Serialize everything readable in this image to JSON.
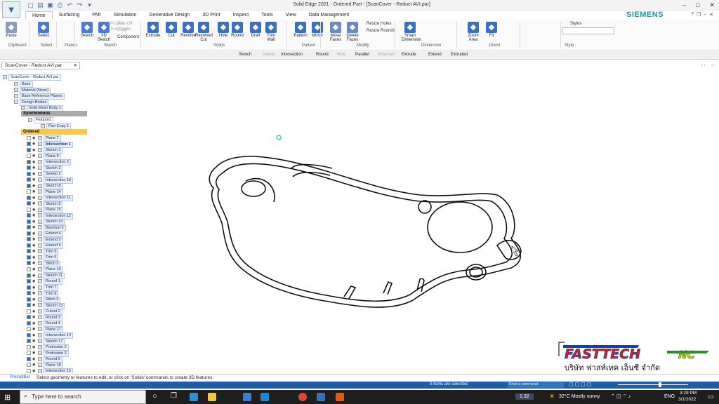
{
  "window": {
    "title": "Solid Edge 2021 - Ordered Part - [ScanCover - Reduct AVI.par]"
  },
  "tabs": [
    "Home",
    "Surfacing",
    "PMI",
    "Simulation",
    "Generative Design",
    "3D Print",
    "Inspect",
    "Tools",
    "View",
    "Data Management"
  ],
  "brand": "SIEMENS",
  "ribbon": {
    "buttons": [
      {
        "label": "Paste",
        "icon": "paste-icon"
      },
      {
        "label": "Select",
        "icon": "select-arrow-icon"
      },
      {
        "label": "Sketch",
        "icon": "sketch-icon"
      },
      {
        "label": "3D Sketch",
        "icon": "3d-sketch-icon"
      },
      {
        "label": "Extrude",
        "icon": "extrude-icon"
      },
      {
        "label": "Cut",
        "icon": "cut-icon"
      },
      {
        "label": "Revolve",
        "icon": "revolve-icon"
      },
      {
        "label": "Revolved Cut",
        "icon": "revolved-cut-icon"
      },
      {
        "label": "Hole",
        "icon": "hole-icon"
      },
      {
        "label": "Round",
        "icon": "round-icon"
      },
      {
        "label": "Draft",
        "icon": "draft-icon"
      },
      {
        "label": "Thin Wall",
        "icon": "thin-wall-icon"
      },
      {
        "label": "Pattern",
        "icon": "pattern-icon"
      },
      {
        "label": "Mirror",
        "icon": "mirror-icon"
      },
      {
        "label": "Move Faces",
        "icon": "move-faces-icon"
      },
      {
        "label": "Delete Faces",
        "icon": "delete-faces-icon"
      },
      {
        "label": "Smart Dimension",
        "icon": "smart-dimension-icon"
      },
      {
        "label": "Zoom Area",
        "icon": "zoom-area-icon"
      },
      {
        "label": "Fit",
        "icon": "fit-icon"
      }
    ],
    "small": {
      "project": "Project",
      "text_profile": "Text Profile",
      "tear_off": "Tear-Off",
      "copy": "Copy",
      "component": "Component",
      "resize_holes": "Resize Holes",
      "resize_rounds": "Resize Rounds",
      "styles": "Styles"
    },
    "groups": [
      "Clipboard",
      "Select",
      "Planes",
      "Sketch",
      "Solids",
      "Pattern",
      "Modify",
      "Dimension",
      "Orient",
      "Style"
    ]
  },
  "command_bar": [
    {
      "label": "Sketch",
      "enabled": true
    },
    {
      "label": "Delete",
      "enabled": false
    },
    {
      "label": "Intersection",
      "enabled": true
    },
    {
      "label": "Round",
      "enabled": true
    },
    {
      "label": "Hole",
      "enabled": false
    },
    {
      "label": "Parallel",
      "enabled": true
    },
    {
      "label": "Attached",
      "enabled": false
    },
    {
      "label": "Extrude",
      "enabled": true
    },
    {
      "label": "Extend",
      "enabled": true
    },
    {
      "label": "Extruded",
      "enabled": true
    }
  ],
  "document_tab": "ScanCover - Reduct AVI.par",
  "tree": {
    "root": "ScanCover - Reduct AVI.par",
    "top": [
      {
        "label": "Base",
        "type": "base"
      },
      {
        "label": "Material (None)",
        "type": "material"
      },
      {
        "label": "Base Reference Planes",
        "type": "planes"
      },
      {
        "label": "Design Bodies",
        "type": "body"
      },
      {
        "label": "Solid Mesh Body 1",
        "type": "body"
      }
    ],
    "sync_header": "Synchronous",
    "sync_children": [
      {
        "label": "Features"
      },
      {
        "label": "Part Copy 1"
      }
    ],
    "ordered_header": "Ordered",
    "ordered": [
      {
        "label": "Plane 7",
        "checked": false
      },
      {
        "label": "Intersection 1",
        "checked": true,
        "bold": true
      },
      {
        "label": "Sketch 1",
        "checked": true
      },
      {
        "label": "Plane 9",
        "checked": false
      },
      {
        "label": "Intersection 2",
        "checked": true
      },
      {
        "label": "Sketch 3",
        "checked": true
      },
      {
        "label": "Sweep 2",
        "checked": true
      },
      {
        "label": "Intersection 10",
        "checked": true
      },
      {
        "label": "Sketch 8",
        "checked": true
      },
      {
        "label": "Plane 14",
        "checked": false
      },
      {
        "label": "Intersection 11",
        "checked": true
      },
      {
        "label": "Sketch 9",
        "checked": true
      },
      {
        "label": "Plane 15",
        "checked": false
      },
      {
        "label": "Intersection 12",
        "checked": true
      },
      {
        "label": "Sketch 10",
        "checked": true
      },
      {
        "label": "BlueSurf 2",
        "checked": true
      },
      {
        "label": "Extend 4",
        "checked": true
      },
      {
        "label": "Extend 5",
        "checked": true
      },
      {
        "label": "Extend 6",
        "checked": true
      },
      {
        "label": "Trim 5",
        "checked": true
      },
      {
        "label": "Trim 6",
        "checked": true
      },
      {
        "label": "Stitch 2",
        "checked": true
      },
      {
        "label": "Plane 16",
        "checked": false
      },
      {
        "label": "Sketch 11",
        "checked": true
      },
      {
        "label": "Round 1",
        "checked": true
      },
      {
        "label": "Trim 7",
        "checked": true
      },
      {
        "label": "Trim 8",
        "checked": true
      },
      {
        "label": "Stitch 3",
        "checked": true
      },
      {
        "label": "Sketch 13",
        "checked": true
      },
      {
        "label": "Cutout 2",
        "checked": false
      },
      {
        "label": "Round 3",
        "checked": true
      },
      {
        "label": "Round 4",
        "checked": true
      },
      {
        "label": "Plane 17",
        "checked": false
      },
      {
        "label": "Intersection 14",
        "checked": true
      },
      {
        "label": "Sketch 17",
        "checked": true
      },
      {
        "label": "Protrusion 2",
        "checked": false
      },
      {
        "label": "Protrusion 3",
        "checked": false
      },
      {
        "label": "Round 5",
        "checked": true
      },
      {
        "label": "Plane 18",
        "checked": false
      },
      {
        "label": "Intersection 15",
        "checked": false
      }
    ]
  },
  "status": {
    "prompt_label": "PromptBar",
    "prompt_text": "Select geometry or features to edit, or click on 'Solids' commands to create 3D features.",
    "items_selected": "0 items are selected",
    "find_placeholder": "Find a command"
  },
  "taskbar": {
    "search_placeholder": "Type here to search",
    "video_time": "1:32",
    "weather": "32°C  Mostly sunny",
    "lang": "ENG",
    "time": "3:29 PM",
    "date": "3/1/2022"
  },
  "watermark": {
    "brand": "FASTTECH",
    "suffix": "NC",
    "thai_line": "บริษัท ฟาสท์เทค เอ็นซี จำกัด"
  },
  "colors": {
    "accent": "#1c5ea8",
    "siemens": "#1a9aa6",
    "ordered_header": "#f7c948",
    "sync_header": "#a8a8a8",
    "logo_red": "#d0201a",
    "logo_blue": "#1a3fa0",
    "logo_green": "#2e8b2e"
  }
}
